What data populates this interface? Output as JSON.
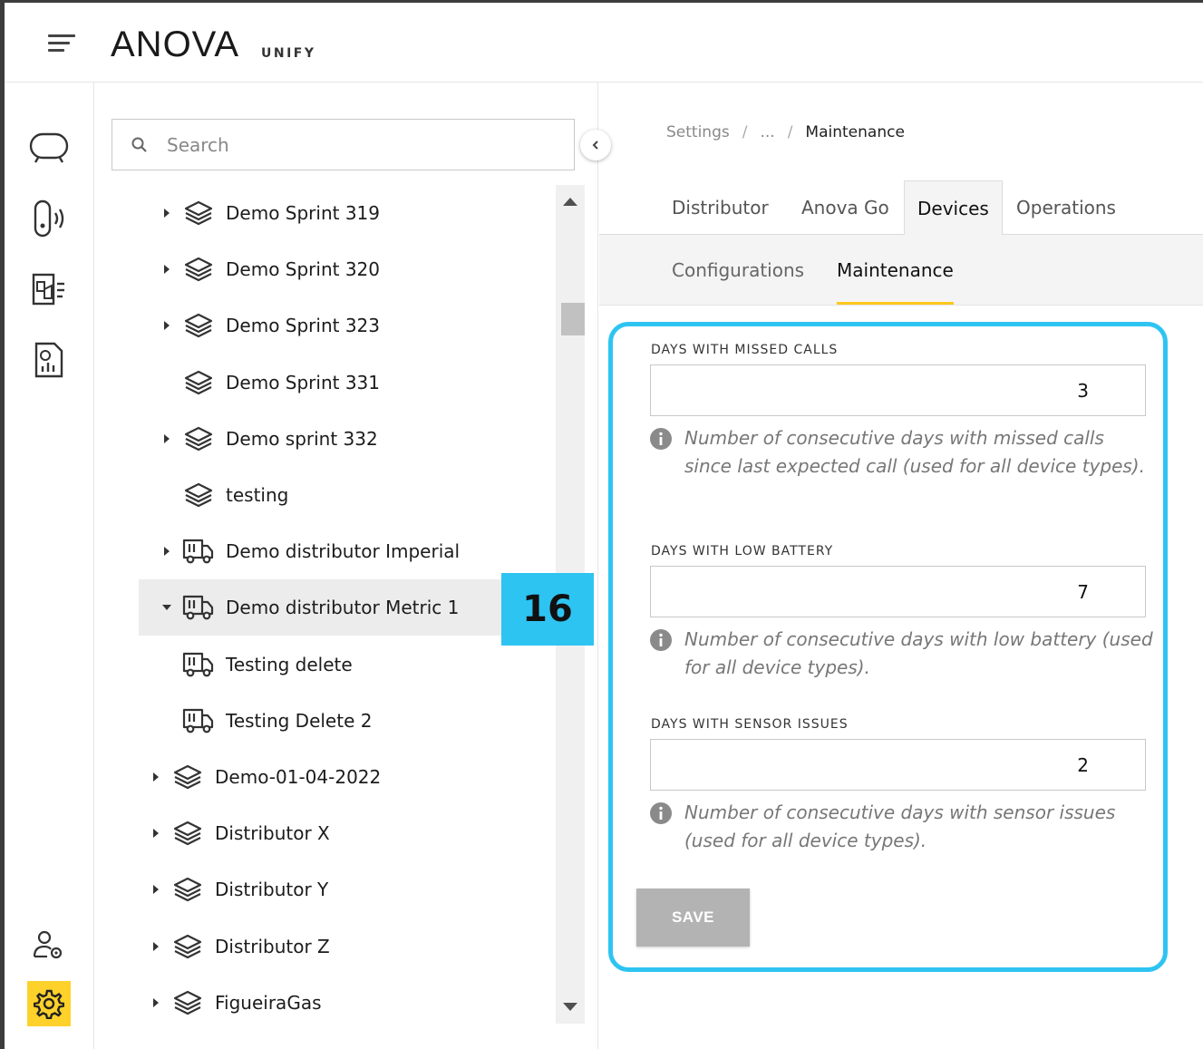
{
  "header": {
    "brand": "ANOVA",
    "brand_sub": "UNIFY"
  },
  "rail": {
    "items": [
      {
        "name": "tank-icon",
        "active": false
      },
      {
        "name": "sensor-icon",
        "active": false
      },
      {
        "name": "truck-dashboard-icon",
        "active": false
      },
      {
        "name": "report-icon",
        "active": false
      },
      {
        "name": "user-settings-icon",
        "active": false
      },
      {
        "name": "gear-icon",
        "active": true
      }
    ],
    "accent_color": "#ffd12b"
  },
  "search": {
    "placeholder": "Search"
  },
  "tree": {
    "items": [
      {
        "label": "Demo Sprint 319",
        "type": "layers",
        "expandable": true,
        "expanded": false,
        "level": 1
      },
      {
        "label": "Demo Sprint 320",
        "type": "layers",
        "expandable": true,
        "expanded": false,
        "level": 1
      },
      {
        "label": "Demo Sprint 323",
        "type": "layers",
        "expandable": true,
        "expanded": false,
        "level": 1
      },
      {
        "label": "Demo Sprint 331",
        "type": "layers",
        "expandable": false,
        "expanded": false,
        "level": 1
      },
      {
        "label": "Demo sprint 332",
        "type": "layers",
        "expandable": true,
        "expanded": false,
        "level": 1
      },
      {
        "label": "testing",
        "type": "layers",
        "expandable": false,
        "expanded": false,
        "level": 1
      },
      {
        "label": "Demo distributor Imperial",
        "type": "truck",
        "expandable": true,
        "expanded": false,
        "level": 1
      },
      {
        "label": "Demo distributor Metric 1",
        "type": "truck",
        "expandable": true,
        "expanded": true,
        "level": 1,
        "selected": true
      },
      {
        "label": "Testing delete",
        "type": "truck",
        "expandable": false,
        "expanded": false,
        "level": 1
      },
      {
        "label": "Testing Delete 2",
        "type": "truck",
        "expandable": false,
        "expanded": false,
        "level": 1
      },
      {
        "label": "Demo-01-04-2022",
        "type": "layers",
        "expandable": true,
        "expanded": false,
        "level": 0
      },
      {
        "label": "Distributor X",
        "type": "layers",
        "expandable": true,
        "expanded": false,
        "level": 0
      },
      {
        "label": "Distributor Y",
        "type": "layers",
        "expandable": true,
        "expanded": false,
        "level": 0
      },
      {
        "label": "Distributor Z",
        "type": "layers",
        "expandable": true,
        "expanded": false,
        "level": 0
      },
      {
        "label": "FigueiraGas",
        "type": "layers",
        "expandable": true,
        "expanded": false,
        "level": 0
      }
    ]
  },
  "callout": {
    "number": "16",
    "color": "#2ec4f1"
  },
  "breadcrumb": {
    "root": "Settings",
    "sep": "/",
    "middle": "...",
    "current": "Maintenance"
  },
  "tabs": [
    {
      "label": "Distributor",
      "active": false
    },
    {
      "label": "Anova Go",
      "active": false
    },
    {
      "label": "Devices",
      "active": true
    },
    {
      "label": "Operations",
      "active": false
    }
  ],
  "subtabs": [
    {
      "label": "Configurations",
      "active": false
    },
    {
      "label": "Maintenance",
      "active": true
    }
  ],
  "form": {
    "missed_calls": {
      "label": "DAYS WITH MISSED CALLS",
      "value": "3",
      "help": "Number of consecutive days with missed calls since last expected call (used for all device types)."
    },
    "low_battery": {
      "label": "DAYS WITH LOW BATTERY",
      "value": "7",
      "help": "Number of consecutive days with low battery (used for all device types)."
    },
    "sensor_issues": {
      "label": "DAYS WITH SENSOR ISSUES",
      "value": "2",
      "help": "Number of consecutive days with sensor issues (used for all device types)."
    },
    "save_label": "SAVE"
  }
}
